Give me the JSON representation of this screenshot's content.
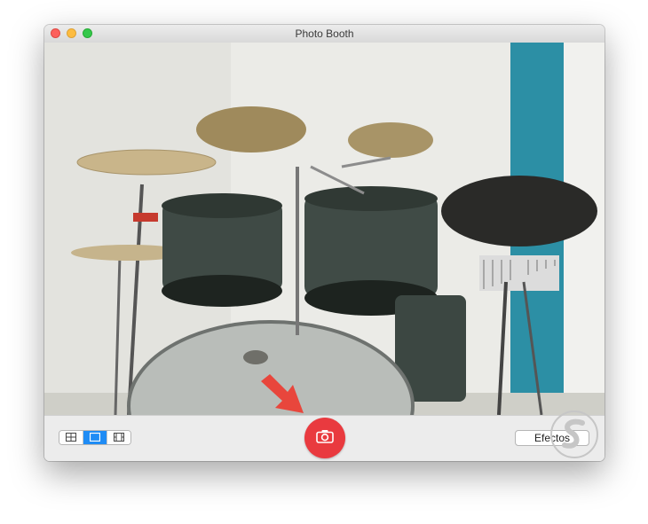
{
  "window": {
    "title": "Photo Booth"
  },
  "toolbar": {
    "view_modes": [
      {
        "icon": "grid-four-icon",
        "active": false
      },
      {
        "icon": "single-photo-icon",
        "active": true
      },
      {
        "icon": "video-film-icon",
        "active": false
      }
    ],
    "shutter_icon": "camera-icon",
    "effects_label": "Efectos"
  },
  "preview": {
    "description_icon": "camera-preview"
  },
  "colors": {
    "shutter": "#e93a3f",
    "active_segment": "#1f8cf5",
    "annotation_arrow": "#e8463c"
  }
}
